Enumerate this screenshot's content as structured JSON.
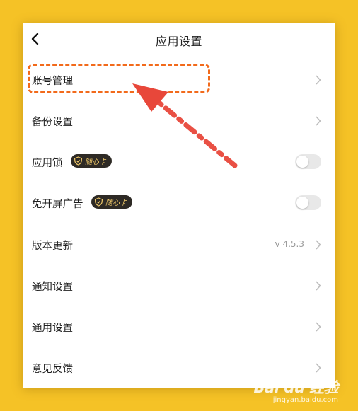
{
  "header": {
    "title": "应用设置",
    "back_icon": "chevron-left-icon"
  },
  "rows": [
    {
      "label": "账号管理"
    },
    {
      "label": "备份设置"
    },
    {
      "label": "应用锁",
      "badge": "随心卡",
      "toggle_on": false
    },
    {
      "label": "免开屏广告",
      "badge": "随心卡",
      "toggle_on": false
    },
    {
      "label": "版本更新",
      "value": "v 4.5.3"
    },
    {
      "label": "通知设置"
    },
    {
      "label": "通用设置"
    },
    {
      "label": "意见反馈"
    }
  ],
  "colors": {
    "background": "#f5c226",
    "highlight": "#f26a1b",
    "arrow": "#e8473a",
    "badge_bg": "#2e2a25",
    "badge_text": "#f0c96a"
  },
  "watermark": {
    "logo": "Bai du 经验",
    "url": "jingyan.baidu.com"
  }
}
